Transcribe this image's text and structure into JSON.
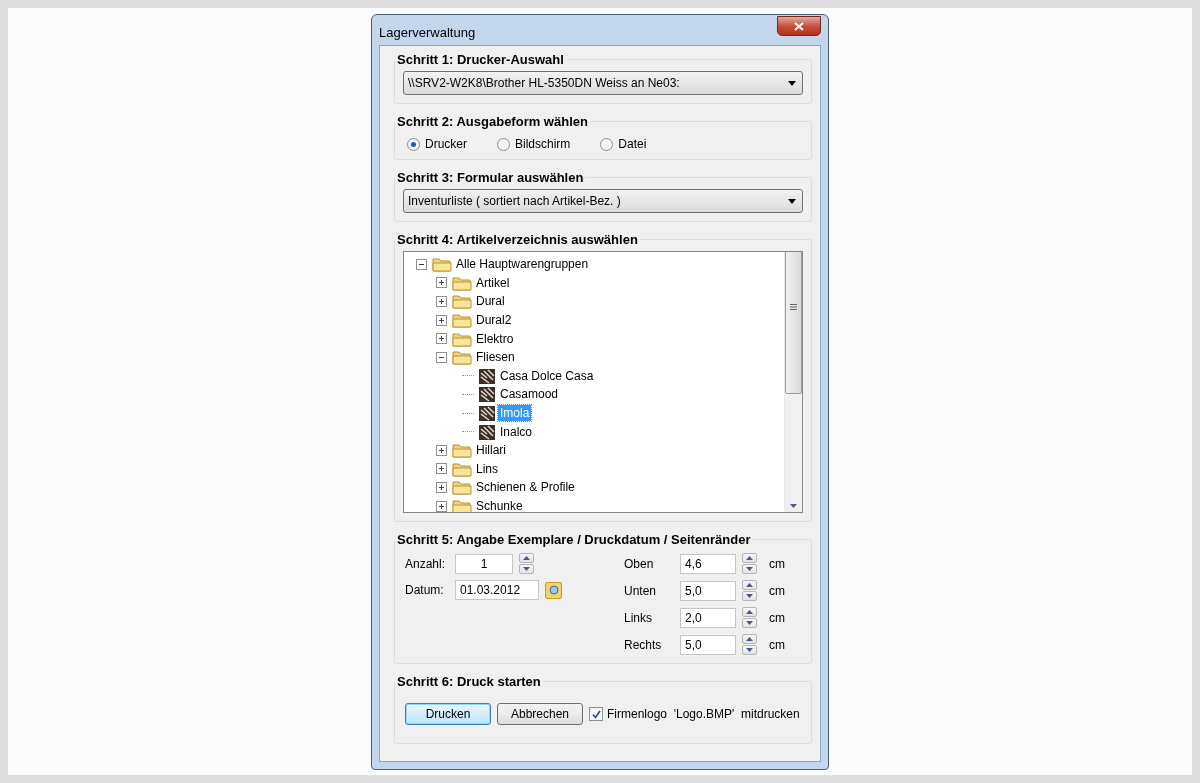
{
  "window": {
    "title": "Lagerverwaltung"
  },
  "steps": [
    {
      "kind": "dropdown",
      "title": "Schritt 1: Drucker-Auswahl",
      "value": "\\\\SRV2-W2K8\\Brother HL-5350DN Weiss an Ne03:"
    },
    {
      "kind": "radios",
      "title": "Schritt 2: Ausgabeform wählen",
      "options": [
        {
          "label": "Drucker",
          "selected": true
        },
        {
          "label": "Bildschirm",
          "selected": false
        },
        {
          "label": "Datei",
          "selected": false
        }
      ]
    },
    {
      "kind": "dropdown",
      "title": "Schritt 3: Formular auswählen",
      "value": "Inventurliste ( sortiert nach Artikel-Bez. )"
    },
    {
      "kind": "tree",
      "title": "Schritt 4: Artikelverzeichnis auswählen",
      "tree": [
        {
          "label": "Alle Hauptwarengruppen",
          "kind": "folder",
          "expanded": true,
          "selected": false,
          "children": [
            {
              "label": "Artikel",
              "kind": "folder",
              "expanded": false,
              "selected": false
            },
            {
              "label": "Dural",
              "kind": "folder",
              "expanded": false,
              "selected": false
            },
            {
              "label": "Dural2",
              "kind": "folder",
              "expanded": false,
              "selected": false
            },
            {
              "label": "Elektro",
              "kind": "folder",
              "expanded": false,
              "selected": false
            },
            {
              "label": "Fliesen",
              "kind": "folder",
              "expanded": true,
              "selected": false,
              "children": [
                {
                  "label": "Casa Dolce Casa",
                  "kind": "article",
                  "selected": false
                },
                {
                  "label": "Casamood",
                  "kind": "article",
                  "selected": false
                },
                {
                  "label": "Imola",
                  "kind": "article",
                  "selected": true
                },
                {
                  "label": "Inalco",
                  "kind": "article",
                  "selected": false
                }
              ]
            },
            {
              "label": "Hillari",
              "kind": "folder",
              "expanded": false,
              "selected": false
            },
            {
              "label": "Lins",
              "kind": "folder",
              "expanded": false,
              "selected": false
            },
            {
              "label": "Schienen & Profile",
              "kind": "folder",
              "expanded": false,
              "selected": false
            },
            {
              "label": "Schunke",
              "kind": "folder",
              "expanded": false,
              "selected": false
            }
          ]
        }
      ]
    },
    {
      "kind": "settings",
      "title": "Schritt 5: Angabe Exemplare / Druckdatum / Seitenränder",
      "count": {
        "label": "Anzahl:",
        "value": "1"
      },
      "date": {
        "label": "Datum:",
        "value": "01.03.2012"
      },
      "margins": [
        {
          "label": "Oben",
          "value": "4,6",
          "unit": "cm"
        },
        {
          "label": "Unten",
          "value": "5,0",
          "unit": "cm"
        },
        {
          "label": "Links",
          "value": "2,0",
          "unit": "cm"
        },
        {
          "label": "Rechts",
          "value": "5,0",
          "unit": "cm"
        }
      ]
    },
    {
      "kind": "actions",
      "title": "Schritt 6: Druck starten",
      "buttons": [
        {
          "label": "Drucken",
          "default": true
        },
        {
          "label": "Abbrechen",
          "default": false
        }
      ],
      "checkbox": {
        "label": "Firmenlogo  'Logo.BMP'  mitdrucken",
        "checked": true
      }
    }
  ]
}
